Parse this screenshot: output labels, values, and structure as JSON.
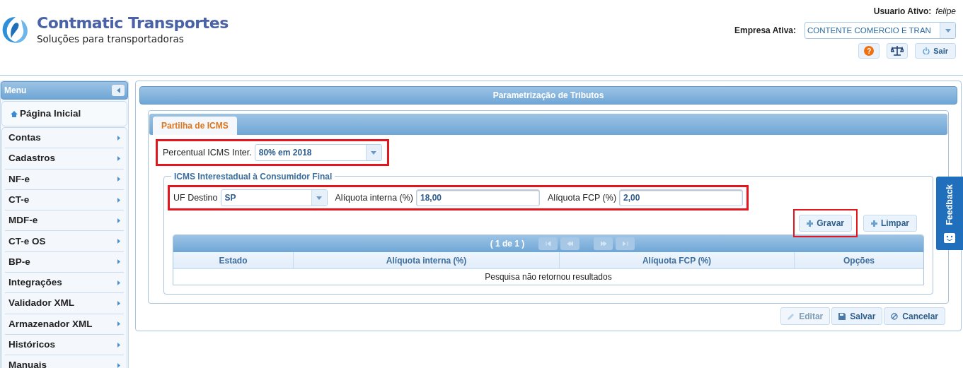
{
  "header": {
    "title": "Contmatic Transportes",
    "subtitle": "Soluções para transportadoras",
    "user_label": "Usuario Ativo:",
    "user": "felipe",
    "company_label": "Empresa Ativa:",
    "company": "CONTENTE COMERCIO E TRAN",
    "logout": "Sair",
    "help": "?"
  },
  "menu": {
    "title": "Menu",
    "home": "Página Inicial",
    "items": [
      {
        "label": "Contas"
      },
      {
        "label": "Cadastros"
      },
      {
        "label": "NF-e"
      },
      {
        "label": "CT-e"
      },
      {
        "label": "MDF-e"
      },
      {
        "label": "CT-e OS"
      },
      {
        "label": "BP-e"
      },
      {
        "label": "Integrações"
      },
      {
        "label": "Validador XML"
      },
      {
        "label": "Armazenador XML"
      },
      {
        "label": "Históricos"
      },
      {
        "label": "Manuais"
      }
    ]
  },
  "panel": {
    "title": "Parametrização de Tributos",
    "tabs": [
      {
        "label": "Partilha de ICMS",
        "selected": true
      }
    ],
    "percentual": {
      "label": "Percentual ICMS Inter.",
      "value": "80% em 2018",
      "highlighted": true
    },
    "fieldset": {
      "legend": "ICMS Interestadual à Consumidor Final",
      "highlighted": true,
      "uf": {
        "label": "UF Destino",
        "value": "SP"
      },
      "interna": {
        "label": "Alíquota interna (%)",
        "value": "18,00"
      },
      "fcp": {
        "label": "Alíquota FCP (%)",
        "value": "2,00"
      },
      "buttons": [
        {
          "label": "Gravar",
          "highlighted": true
        },
        {
          "label": "Limpar",
          "highlighted": false
        }
      ],
      "table": {
        "pager": "( 1 de 1 )",
        "columns": [
          "Estado",
          "Alíquota interna (%)",
          "Alíquota FCP (%)",
          "Opções"
        ],
        "empty": "Pesquisa não retornou resultados"
      }
    },
    "actions": [
      {
        "kind": "edit",
        "label": "Editar",
        "disabled": true
      },
      {
        "kind": "save",
        "label": "Salvar",
        "disabled": false
      },
      {
        "kind": "cancel",
        "label": "Cancelar",
        "disabled": false
      }
    ]
  },
  "feedback": "Feedback"
}
